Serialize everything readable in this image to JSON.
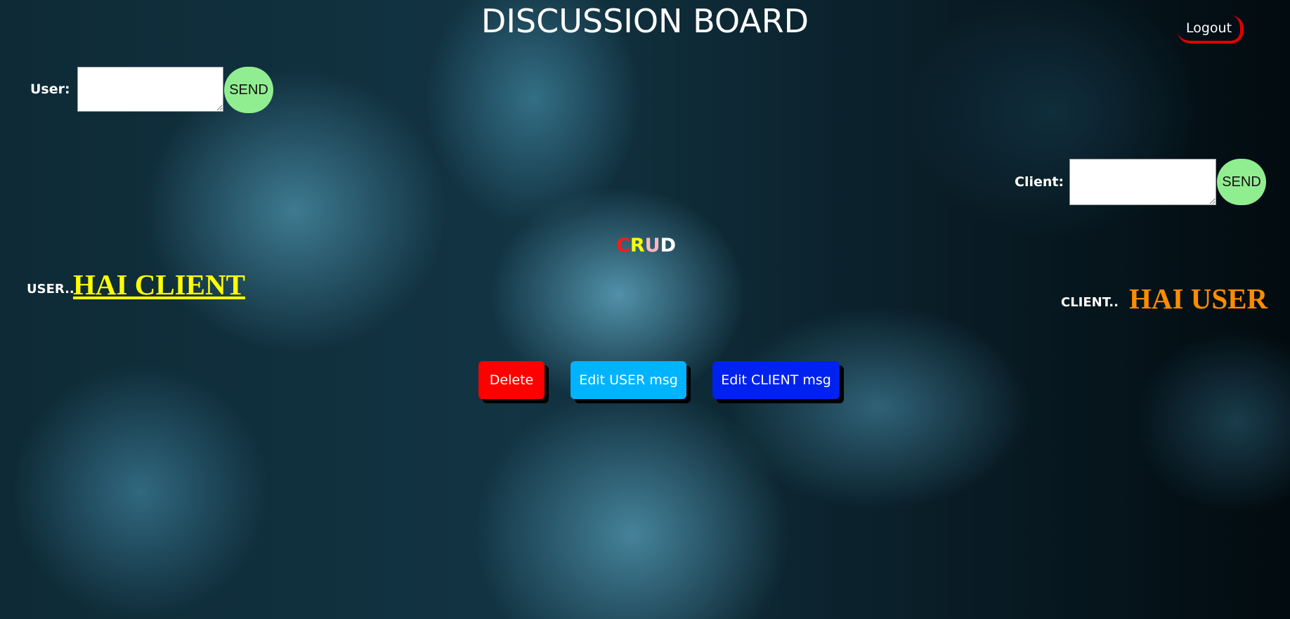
{
  "header": {
    "title": "DISCUSSION BOARD",
    "logout_label": "Logout"
  },
  "user_panel": {
    "label": "User:",
    "input_value": "",
    "send_label": "SEND"
  },
  "client_panel": {
    "label": "Client:",
    "input_value": "",
    "send_label": "SEND"
  },
  "crud": {
    "letters": [
      {
        "char": "C",
        "color": "#ff1a1a"
      },
      {
        "char": "R",
        "color": "#ffff00"
      },
      {
        "char": "U",
        "color": "#ffb6c1"
      },
      {
        "char": "D",
        "color": "#ffffff"
      }
    ]
  },
  "messages": {
    "user_prefix": "USER..",
    "user_text": "HAI CLIENT",
    "client_prefix": "CLIENT..",
    "client_text": "HAI USER"
  },
  "actions": {
    "delete_label": "Delete",
    "edit_user_label": "Edit USER msg",
    "edit_client_label": "Edit CLIENT msg"
  },
  "colors": {
    "send": "#90ee90",
    "delete": "#ff0000",
    "edit_user": "#00b3ff",
    "edit_client": "#0022ee",
    "user_message": "#ffff00",
    "client_message": "#ff8c00",
    "logout_accent": "#e00000"
  }
}
